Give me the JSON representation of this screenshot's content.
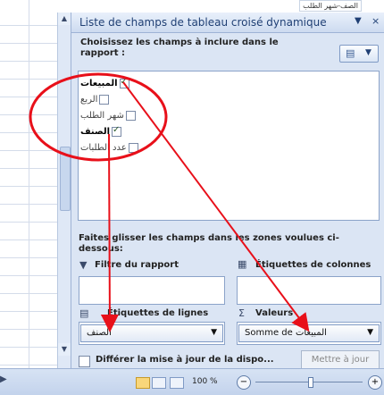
{
  "top_cell": "الصف-شهر الطلب",
  "pane": {
    "title": "Liste de champs de tableau croisé dynamique",
    "title_dropdown": "▼",
    "close": "×",
    "choose_text": "Choisissez les champs à inclure dans le rapport :"
  },
  "fields": [
    {
      "label": "المبيعات",
      "checked": true,
      "bold": true
    },
    {
      "label": "الربع",
      "checked": false,
      "bold": false
    },
    {
      "label": "شهر الطلب",
      "checked": false,
      "bold": false
    },
    {
      "label": "الصنف",
      "checked": true,
      "bold": true
    },
    {
      "label": "عدد الطلبات",
      "checked": false,
      "bold": false
    }
  ],
  "drag_text": "Faites glisser les champs dans les zones voulues ci-dessous:",
  "zones": {
    "filter_label": "Filtre du rapport",
    "columns_label": "Étiquettes de colonnes",
    "rows_label": "Étiquettes de lignes",
    "values_label": "Valeurs",
    "rows_item": "الصنف",
    "values_item": "Somme de المبيعات"
  },
  "footer": {
    "defer_label": "Différer la mise à jour de la dispo...",
    "update_button": "Mettre à jour"
  },
  "status": {
    "zoom": "100 %",
    "zoom_minus": "−",
    "zoom_plus": "+"
  },
  "icons": {
    "filter": "filter-icon",
    "columns": "columns-icon",
    "rows": "rows-icon",
    "values": "sigma-icon",
    "layout": "layout-icon"
  },
  "colors": {
    "annotation": "#e8101a",
    "pane_bg": "#dbe5f4",
    "title_text": "#1f3f74"
  }
}
